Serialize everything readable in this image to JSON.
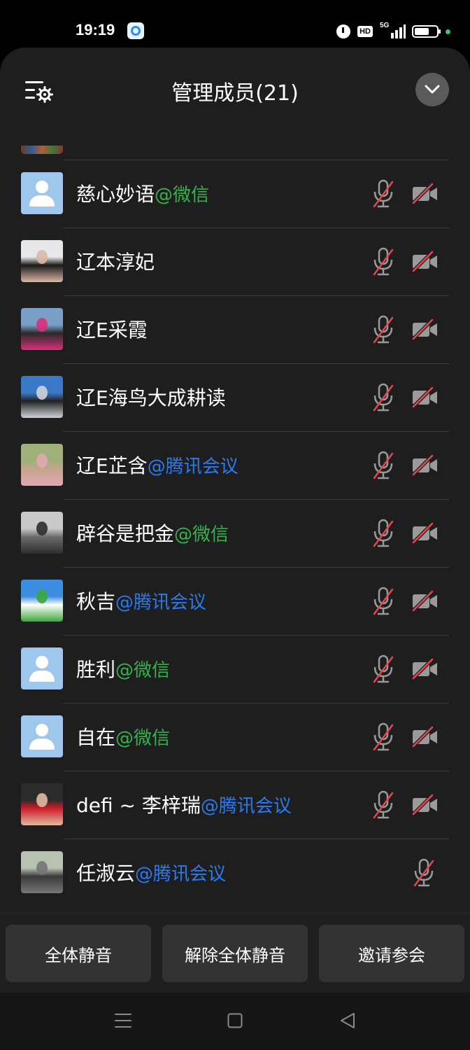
{
  "status_bar": {
    "time": "19:19",
    "hd_label": "HD",
    "network_label": "5G",
    "icons": [
      "meeting-app-icon",
      "alarm-icon",
      "hd-icon",
      "signal-icon",
      "battery-icon",
      "status-dot-icon"
    ]
  },
  "header": {
    "title": "管理成员(21)",
    "settings_icon": "list-settings-icon",
    "collapse_icon": "chevron-down-icon"
  },
  "members": [
    {
      "name": "慈心妙语",
      "tag": "@微信",
      "tag_type": "wechat",
      "avatar": "default",
      "mic_muted": true,
      "cam_off": true
    },
    {
      "name": "辽本淳妃",
      "tag": "",
      "tag_type": "",
      "avatar": "photo",
      "avatar_colors": [
        "#e8e8ea",
        "#1a1a1a",
        "#d9b9a6"
      ],
      "mic_muted": true,
      "cam_off": true
    },
    {
      "name": "辽E采霞",
      "tag": "",
      "tag_type": "",
      "avatar": "photo",
      "avatar_colors": [
        "#7aa0c8",
        "#2a2a2a",
        "#d8307a"
      ],
      "mic_muted": true,
      "cam_off": true
    },
    {
      "name": "辽E海鸟大成耕读",
      "tag": "",
      "tag_type": "",
      "avatar": "photo",
      "avatar_colors": [
        "#3c78c8",
        "#222",
        "#cfd3d8"
      ],
      "mic_muted": true,
      "cam_off": true
    },
    {
      "name": "辽E芷含",
      "tag": "@腾讯会议",
      "tag_type": "tencent",
      "avatar": "photo",
      "avatar_colors": [
        "#9fb07a",
        "#c7a58c",
        "#e3a6b4"
      ],
      "mic_muted": true,
      "cam_off": true
    },
    {
      "name": "辟谷是把金",
      "tag": "@微信",
      "tag_type": "wechat",
      "avatar": "photo",
      "avatar_colors": [
        "#c9c9c9",
        "#6b6b6b",
        "#2e2e2e"
      ],
      "mic_muted": true,
      "cam_off": true
    },
    {
      "name": "秋吉",
      "tag": "@腾讯会议",
      "tag_type": "tencent",
      "avatar": "photo",
      "avatar_colors": [
        "#3d8ee0",
        "#ffffff",
        "#3da63d"
      ],
      "mic_muted": true,
      "cam_off": true
    },
    {
      "name": "胜利",
      "tag": "@微信",
      "tag_type": "wechat",
      "avatar": "default",
      "mic_muted": true,
      "cam_off": true
    },
    {
      "name": "自在",
      "tag": "@微信",
      "tag_type": "wechat",
      "avatar": "default",
      "mic_muted": true,
      "cam_off": true
    },
    {
      "name": "defi ~ 李梓瑞",
      "tag": "@腾讯会议",
      "tag_type": "tencent",
      "avatar": "photo",
      "avatar_colors": [
        "#2b2b2b",
        "#d11c2a",
        "#e0b9a0"
      ],
      "mic_muted": true,
      "cam_off": true
    },
    {
      "name": "任淑云",
      "tag": "@腾讯会议",
      "tag_type": "tencent",
      "avatar": "photo",
      "avatar_colors": [
        "#b7c2b0",
        "#3a3a3a",
        "#777"
      ],
      "mic_muted": true,
      "cam_off": false
    }
  ],
  "footer": {
    "mute_all": "全体静音",
    "unmute_all": "解除全体静音",
    "invite": "邀请参会"
  },
  "colors": {
    "muted_red": "#e5484d",
    "icon_gray": "#9a9a9a",
    "wechat_green": "#35b34a",
    "tencent_blue": "#2b7bf0"
  }
}
